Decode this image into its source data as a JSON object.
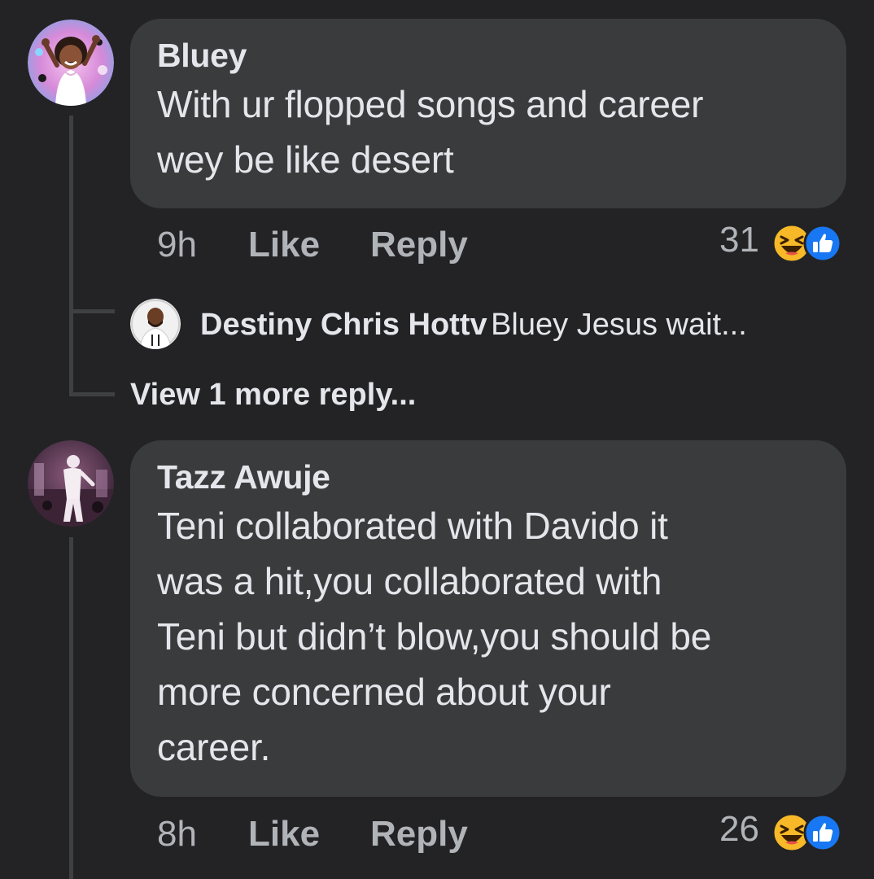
{
  "comments": [
    {
      "author": "Bluey",
      "text": "With ur flopped songs and career\nwey be like desert",
      "time": "9h",
      "like_label": "Like",
      "reply_label": "Reply",
      "reaction_count": "31",
      "reaction_icons": [
        "haha-icon",
        "like-icon"
      ],
      "reply_preview": {
        "author": "Destiny Chris Hottv",
        "text": "Bluey Jesus wait..."
      },
      "view_more_label": "View 1 more reply..."
    },
    {
      "author": "Tazz Awuje",
      "text": "Teni collaborated with Davido it\nwas a hit,you collaborated with\nTeni but didn’t blow,you should be\nmore concerned about your\ncareer.",
      "time": "8h",
      "like_label": "Like",
      "reply_label": "Reply",
      "reaction_count": "26",
      "reaction_icons": [
        "haha-icon",
        "like-icon"
      ]
    }
  ],
  "colors": {
    "background": "#232325",
    "bubble": "#3a3b3c",
    "text": "#e4e6eb",
    "muted": "#b0b3b8",
    "haha_yellow": "#f7b928",
    "like_blue": "#1877f2"
  }
}
